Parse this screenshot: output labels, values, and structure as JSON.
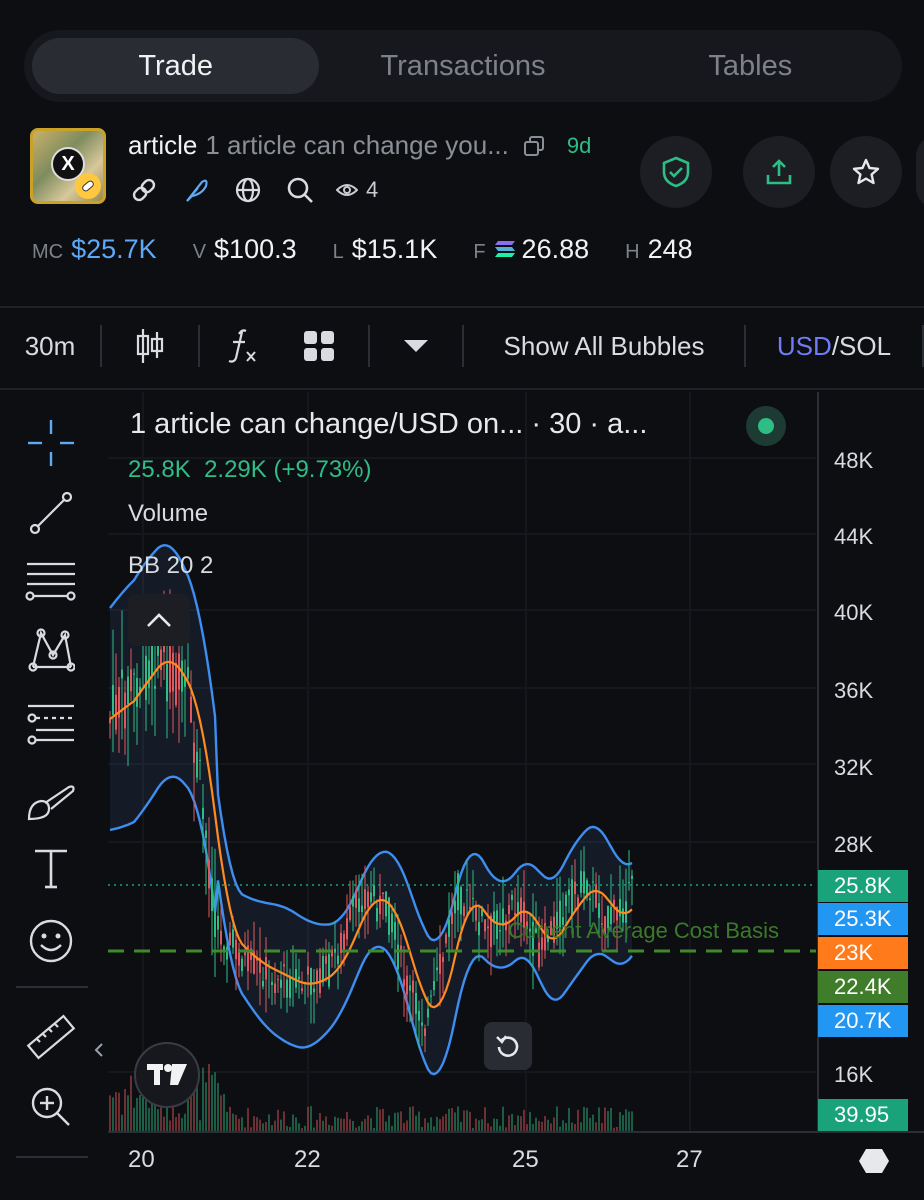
{
  "tabs": [
    {
      "label": "Trade",
      "active": true
    },
    {
      "label": "Transactions",
      "active": false
    },
    {
      "label": "Tables",
      "active": false
    }
  ],
  "token": {
    "ticker": "article",
    "full_name": "1 article can change you...",
    "age": "9d",
    "views": "4",
    "avatar_badge": "X"
  },
  "stats": [
    {
      "label": "MC",
      "value": "$25.7K",
      "highlight": true
    },
    {
      "label": "V",
      "value": "$100.3"
    },
    {
      "label": "L",
      "value": "$15.1K"
    },
    {
      "label": "F",
      "value": "26.88",
      "icon": "solana-icon"
    },
    {
      "label": "H",
      "value": "248"
    }
  ],
  "toolbar": {
    "interval": "30m",
    "bubbles_label": "Show All Bubbles",
    "currency_usd": "USD",
    "currency_sep": "/",
    "currency_sol": "SOL"
  },
  "legend": {
    "title": "1 article can change/USD on... · 30 · a...",
    "value": "25.8K",
    "change": "2.29K (+9.73%)",
    "volume_label": "Volume",
    "bb_label": "BB 20 2"
  },
  "cost_basis_label": "Current Average Cost Basis",
  "chart_data": {
    "type": "candlestick",
    "y_ticks": [
      "48K",
      "44K",
      "40K",
      "36K",
      "32K",
      "28K",
      "16K"
    ],
    "x_ticks": [
      "20",
      "22",
      "25",
      "27"
    ],
    "price_tags": [
      {
        "value": "25.8K",
        "color": "#1aa37a"
      },
      {
        "value": "25.3K",
        "color": "#2196f3"
      },
      {
        "value": "23K",
        "color": "#ff7a1a"
      },
      {
        "value": "22.4K",
        "color": "#3f7d2a"
      },
      {
        "value": "20.7K",
        "color": "#2196f3"
      },
      {
        "value": "39.95",
        "color": "#1aa37a"
      }
    ],
    "indicators": [
      "Volume",
      "BB 20 2"
    ],
    "current_price": 25.8,
    "cost_basis": 23
  },
  "colors": {
    "up": "#2ebd85",
    "down": "#e0585f",
    "bb_band": "#3d8ef0",
    "bb_mid": "#ff8a1f",
    "cost_basis": "#3f8a2a",
    "accent_blue": "#5fa8f5"
  }
}
